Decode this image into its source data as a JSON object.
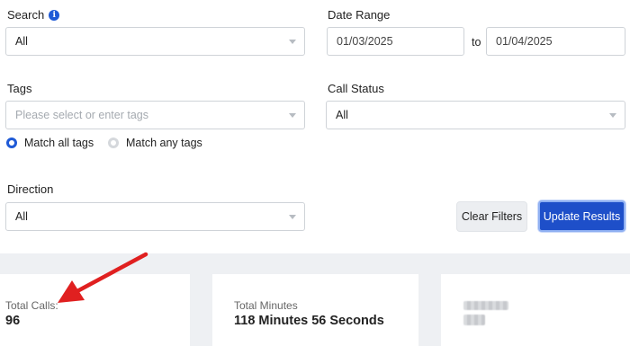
{
  "filters": {
    "search": {
      "label": "Search",
      "value": "All"
    },
    "date_range": {
      "label": "Date Range",
      "from": "01/03/2025",
      "to_label": "to",
      "to": "01/04/2025"
    },
    "tags": {
      "label": "Tags",
      "placeholder": "Please select or enter tags",
      "options": [
        {
          "label": "Match all tags",
          "selected": true
        },
        {
          "label": "Match any tags",
          "selected": false
        }
      ]
    },
    "call_status": {
      "label": "Call Status",
      "value": "All"
    },
    "direction": {
      "label": "Direction",
      "value": "All"
    }
  },
  "buttons": {
    "clear": "Clear Filters",
    "update": "Update Results"
  },
  "stats": {
    "total_calls": {
      "label": "Total Calls:",
      "value": "96"
    },
    "total_minutes": {
      "label": "Total Minutes",
      "value": "118 Minutes 56 Seconds"
    }
  },
  "colors": {
    "primary": "#1e4fc9",
    "arrow": "#e02020",
    "stats_background": "#eef0f3"
  }
}
